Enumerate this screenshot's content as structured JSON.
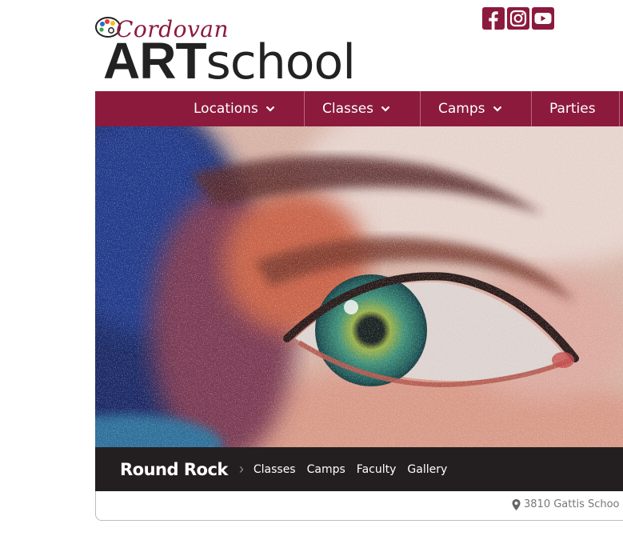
{
  "brand": {
    "script_name": "Cordovan",
    "main_bold": "ART",
    "main_light": "school",
    "color": "#8c1a3c"
  },
  "social": [
    {
      "icon": "facebook-icon"
    },
    {
      "icon": "instagram-icon"
    },
    {
      "icon": "youtube-icon"
    }
  ],
  "nav": {
    "items": [
      {
        "label": "Locations",
        "has_dropdown": true
      },
      {
        "label": "Classes",
        "has_dropdown": true
      },
      {
        "label": "Camps",
        "has_dropdown": true
      },
      {
        "label": "Parties",
        "has_dropdown": false
      }
    ],
    "bg_color": "#8c1a3c"
  },
  "breadcrumb": {
    "location": "Round Rock",
    "links": [
      "Classes",
      "Camps",
      "Faculty",
      "Gallery"
    ]
  },
  "address": {
    "icon": "map-marker-icon",
    "text": "3810 Gattis Schoo"
  }
}
